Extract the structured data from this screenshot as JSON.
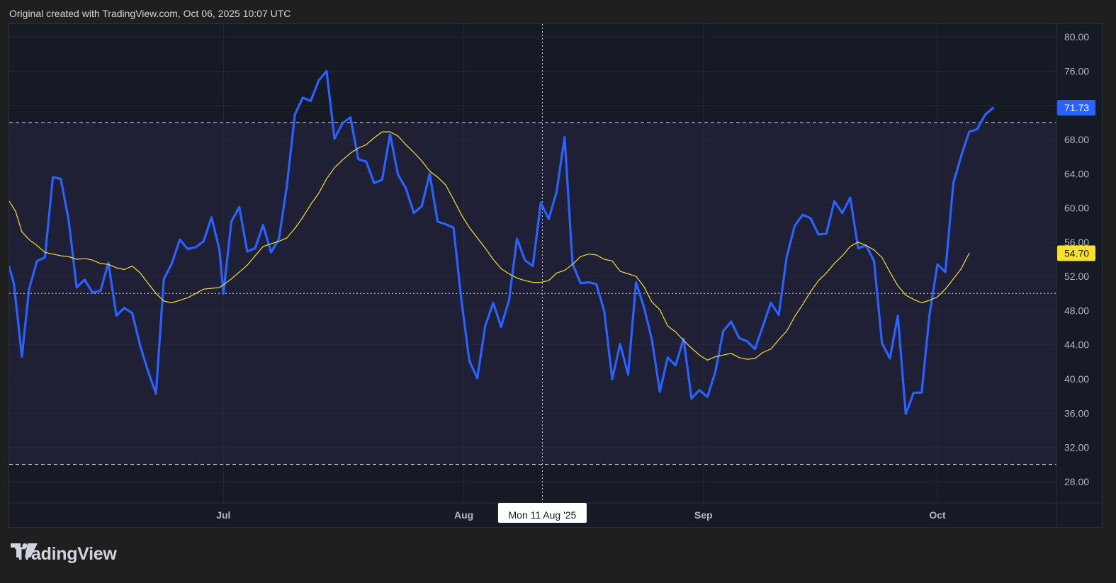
{
  "header": {
    "caption": "Original created with TradingView.com, Oct 06, 2025 10:07 UTC"
  },
  "footer": {
    "brand": "TradingView"
  },
  "colors": {
    "rsi": "#2962ff",
    "ma": "#f7e12c",
    "grid": "#2a2e39",
    "band": "#1f1f35",
    "crosshair_label_bg": "#ffffff",
    "axis_text": "#b2b5be",
    "bg": "#161a25"
  },
  "chart_data": {
    "type": "line",
    "x_range": [
      0,
      132
    ],
    "ylim": [
      25.5,
      81.5
    ],
    "y_ticks": [
      "80.00",
      "76.00",
      "72.00",
      "68.00",
      "64.00",
      "60.00",
      "56.00",
      "52.00",
      "48.00",
      "44.00",
      "40.00",
      "36.00",
      "32.00",
      "28.00"
    ],
    "x_ticks": [
      {
        "label": "Jul",
        "x": 27
      },
      {
        "label": "Aug",
        "x": 57.3
      },
      {
        "label": "Sep",
        "x": 87.5
      },
      {
        "label": "Oct",
        "x": 117
      }
    ],
    "hlines": [
      {
        "value": 70,
        "style": "dashed"
      },
      {
        "value": 50,
        "style": "dotted"
      },
      {
        "value": 30,
        "style": "dashed"
      }
    ],
    "crosshair": {
      "x": 67.2,
      "label": "Mon 11 Aug '25"
    },
    "series": [
      {
        "name": "",
        "values": [
          [
            0,
            53.1
          ],
          [
            0.6,
            51.1
          ],
          [
            1.6,
            42.6
          ],
          [
            2.5,
            50.5
          ],
          [
            3.5,
            53.8
          ],
          [
            4.5,
            54.2
          ],
          [
            5.5,
            63.6
          ],
          [
            6.5,
            63.4
          ],
          [
            7.5,
            58.5
          ],
          [
            8.5,
            50.7
          ],
          [
            9.5,
            51.6
          ],
          [
            10.5,
            50.1
          ],
          [
            11.5,
            50.3
          ],
          [
            12.5,
            53.6
          ],
          [
            13.5,
            47.4
          ],
          [
            14.5,
            48.3
          ],
          [
            15.5,
            47.7
          ],
          [
            16.5,
            43.9
          ],
          [
            17.5,
            40.9
          ],
          [
            18.5,
            38.3
          ],
          [
            19.5,
            51.7
          ],
          [
            20.5,
            53.5
          ],
          [
            21.5,
            56.3
          ],
          [
            22.5,
            55.2
          ],
          [
            23.5,
            55.4
          ],
          [
            24.5,
            56.1
          ],
          [
            25.5,
            58.9
          ],
          [
            26.5,
            55.1
          ],
          [
            27,
            50.0
          ],
          [
            28,
            58.4
          ],
          [
            29,
            60.1
          ],
          [
            30,
            54.9
          ],
          [
            31,
            55.3
          ],
          [
            32,
            58.0
          ],
          [
            33,
            54.8
          ],
          [
            34,
            56.4
          ],
          [
            35,
            62.6
          ],
          [
            36,
            70.9
          ],
          [
            37,
            72.9
          ],
          [
            38,
            72.5
          ],
          [
            39,
            74.9
          ],
          [
            40,
            76.0
          ],
          [
            41,
            68.1
          ],
          [
            42,
            69.9
          ],
          [
            43,
            70.6
          ],
          [
            44,
            65.7
          ],
          [
            45,
            65.4
          ],
          [
            46,
            62.9
          ],
          [
            47,
            63.3
          ],
          [
            48,
            68.6
          ],
          [
            49,
            63.9
          ],
          [
            50,
            62.3
          ],
          [
            51,
            59.4
          ],
          [
            52,
            60.2
          ],
          [
            53,
            64.0
          ],
          [
            54,
            58.4
          ],
          [
            55,
            58.1
          ],
          [
            56,
            57.7
          ],
          [
            57,
            49.2
          ],
          [
            58,
            42.1
          ],
          [
            59,
            40.1
          ],
          [
            60,
            46.2
          ],
          [
            61,
            48.9
          ],
          [
            62,
            46.1
          ],
          [
            63,
            49.2
          ],
          [
            64,
            56.4
          ],
          [
            65,
            53.9
          ],
          [
            66,
            53.2
          ],
          [
            67,
            60.6
          ],
          [
            68,
            58.7
          ],
          [
            69,
            61.9
          ],
          [
            70,
            68.3
          ],
          [
            71,
            53.5
          ],
          [
            72,
            51.2
          ],
          [
            73,
            51.3
          ],
          [
            74,
            51.1
          ],
          [
            75,
            47.9
          ],
          [
            76,
            40.0
          ],
          [
            77,
            44.1
          ],
          [
            78,
            40.5
          ],
          [
            79,
            51.3
          ],
          [
            80,
            48.4
          ],
          [
            81,
            44.6
          ],
          [
            82,
            38.5
          ],
          [
            83,
            42.5
          ],
          [
            84,
            41.6
          ],
          [
            85,
            44.7
          ],
          [
            86,
            37.7
          ],
          [
            87,
            38.7
          ],
          [
            88,
            37.9
          ],
          [
            89,
            40.8
          ],
          [
            90,
            45.6
          ],
          [
            91,
            46.7
          ],
          [
            92,
            44.8
          ],
          [
            93,
            44.4
          ],
          [
            94,
            43.5
          ],
          [
            95,
            46.2
          ],
          [
            96,
            48.9
          ],
          [
            97,
            47.5
          ],
          [
            98,
            54.3
          ],
          [
            99,
            57.9
          ],
          [
            100,
            59.2
          ],
          [
            101,
            58.8
          ],
          [
            102,
            56.9
          ],
          [
            103,
            57.0
          ],
          [
            104,
            60.8
          ],
          [
            105,
            59.4
          ],
          [
            106,
            61.2
          ],
          [
            107,
            55.3
          ],
          [
            108,
            55.6
          ],
          [
            109,
            53.8
          ],
          [
            110,
            44.2
          ],
          [
            111,
            42.4
          ],
          [
            112,
            47.4
          ],
          [
            113,
            35.9
          ],
          [
            114,
            38.4
          ],
          [
            115,
            38.4
          ],
          [
            116,
            47.5
          ],
          [
            117,
            53.4
          ],
          [
            118,
            52.5
          ],
          [
            119,
            62.9
          ],
          [
            120,
            66.1
          ],
          [
            121,
            68.9
          ],
          [
            122,
            69.2
          ],
          [
            123,
            70.9
          ],
          [
            124,
            71.7
          ]
        ]
      },
      {
        "name": "",
        "values": [
          [
            0,
            60.8
          ],
          [
            0.8,
            59.6
          ],
          [
            1.6,
            57.2
          ],
          [
            2.5,
            56.3
          ],
          [
            3.5,
            55.6
          ],
          [
            4.5,
            54.8
          ],
          [
            5.5,
            54.6
          ],
          [
            6.5,
            54.4
          ],
          [
            7.5,
            54.3
          ],
          [
            8.5,
            54.0
          ],
          [
            9.5,
            54.1
          ],
          [
            10.5,
            53.9
          ],
          [
            11.5,
            53.5
          ],
          [
            12.5,
            53.4
          ],
          [
            13.5,
            53.0
          ],
          [
            14.5,
            52.8
          ],
          [
            15.5,
            53.2
          ],
          [
            16.5,
            52.4
          ],
          [
            17.5,
            51.2
          ],
          [
            18.5,
            50.0
          ],
          [
            19.5,
            49.1
          ],
          [
            20.5,
            48.9
          ],
          [
            21.5,
            49.2
          ],
          [
            22.5,
            49.5
          ],
          [
            23.5,
            50.0
          ],
          [
            24.5,
            50.5
          ],
          [
            25.5,
            50.6
          ],
          [
            26.5,
            50.7
          ],
          [
            27,
            51.0
          ],
          [
            28,
            51.7
          ],
          [
            29,
            52.5
          ],
          [
            30,
            53.3
          ],
          [
            31,
            54.4
          ],
          [
            32,
            55.5
          ],
          [
            33,
            55.8
          ],
          [
            34,
            56.1
          ],
          [
            35,
            56.5
          ],
          [
            36,
            57.6
          ],
          [
            37,
            58.9
          ],
          [
            38,
            60.4
          ],
          [
            39,
            61.7
          ],
          [
            40,
            63.4
          ],
          [
            41,
            64.7
          ],
          [
            42,
            65.6
          ],
          [
            43,
            66.4
          ],
          [
            44,
            67.0
          ],
          [
            45,
            67.4
          ],
          [
            46,
            68.2
          ],
          [
            47,
            68.9
          ],
          [
            48,
            68.9
          ],
          [
            49,
            68.4
          ],
          [
            50,
            67.4
          ],
          [
            51,
            66.5
          ],
          [
            52,
            65.5
          ],
          [
            53,
            64.3
          ],
          [
            54,
            63.6
          ],
          [
            55,
            62.7
          ],
          [
            56,
            61.0
          ],
          [
            57,
            59.2
          ],
          [
            58,
            57.7
          ],
          [
            59,
            56.5
          ],
          [
            60,
            55.3
          ],
          [
            61,
            54.0
          ],
          [
            62,
            52.9
          ],
          [
            63,
            52.3
          ],
          [
            64,
            51.8
          ],
          [
            65,
            51.5
          ],
          [
            66,
            51.3
          ],
          [
            67,
            51.3
          ],
          [
            68,
            51.5
          ],
          [
            69,
            52.4
          ],
          [
            70,
            52.7
          ],
          [
            71,
            53.4
          ],
          [
            72,
            54.3
          ],
          [
            73,
            54.6
          ],
          [
            74,
            54.5
          ],
          [
            75,
            54.0
          ],
          [
            76,
            53.8
          ],
          [
            77,
            52.6
          ],
          [
            78,
            52.3
          ],
          [
            79,
            52.0
          ],
          [
            80,
            50.8
          ],
          [
            81,
            49.0
          ],
          [
            82,
            48.1
          ],
          [
            83,
            46.2
          ],
          [
            84,
            45.5
          ],
          [
            85,
            44.5
          ],
          [
            86,
            43.6
          ],
          [
            87,
            42.8
          ],
          [
            88,
            42.2
          ],
          [
            89,
            42.6
          ],
          [
            90,
            42.8
          ],
          [
            91,
            43.0
          ],
          [
            92,
            42.5
          ],
          [
            93,
            42.3
          ],
          [
            94,
            42.4
          ],
          [
            95,
            43.1
          ],
          [
            96,
            43.5
          ],
          [
            97,
            44.6
          ],
          [
            98,
            45.6
          ],
          [
            99,
            47.3
          ],
          [
            100,
            48.7
          ],
          [
            101,
            50.2
          ],
          [
            102,
            51.5
          ],
          [
            103,
            52.4
          ],
          [
            104,
            53.5
          ],
          [
            105,
            54.4
          ],
          [
            106,
            55.5
          ],
          [
            107,
            56.0
          ],
          [
            108,
            55.6
          ],
          [
            109,
            55.1
          ],
          [
            110,
            54.2
          ],
          [
            111,
            52.5
          ],
          [
            112,
            50.9
          ],
          [
            113,
            49.8
          ],
          [
            114,
            49.3
          ],
          [
            115,
            48.9
          ],
          [
            116,
            49.2
          ],
          [
            117,
            49.6
          ],
          [
            118,
            50.5
          ],
          [
            119,
            51.7
          ],
          [
            120,
            52.9
          ],
          [
            121,
            54.7
          ]
        ]
      }
    ],
    "last_value_labels": [
      {
        "series": 0,
        "text": "71.73",
        "value": 71.73,
        "bg": "#2962ff",
        "fg": "#ffffff"
      },
      {
        "series": 1,
        "text": "54.70",
        "value": 54.7,
        "bg": "#f7e12c",
        "fg": "#131722"
      }
    ]
  }
}
